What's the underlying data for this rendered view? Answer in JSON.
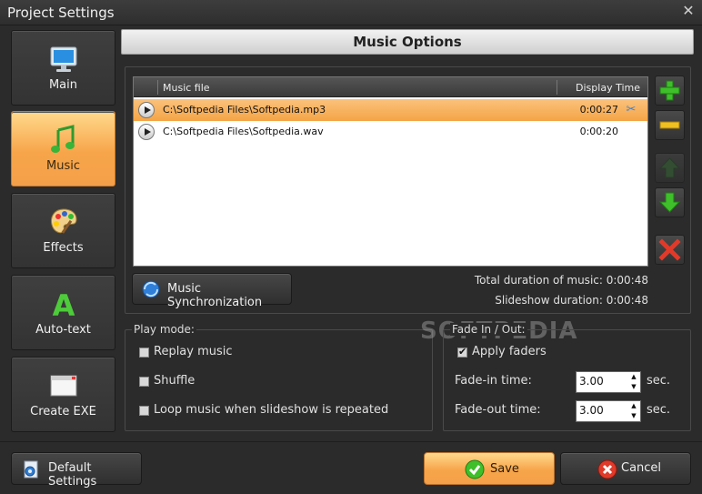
{
  "window": {
    "title": "Project Settings",
    "close_glyph": "✕"
  },
  "sidebar": {
    "items": [
      {
        "label": "Main",
        "icon": "monitor-icon"
      },
      {
        "label": "Music",
        "icon": "music-note-icon",
        "active": true
      },
      {
        "label": "Effects",
        "icon": "palette-icon"
      },
      {
        "label": "Auto-text",
        "icon": "letter-a-icon"
      },
      {
        "label": "Create EXE",
        "icon": "window-icon"
      }
    ]
  },
  "panel": {
    "title": "Music Options"
  },
  "music_list": {
    "columns": [
      "Music file",
      "Display Time"
    ],
    "rows": [
      {
        "file": "C:\\Softpedia Files\\Softpedia.mp3",
        "time": "0:00:27",
        "selected": true
      },
      {
        "file": "C:\\Softpedia Files\\Softpedia.wav",
        "time": "0:00:20",
        "selected": false
      }
    ]
  },
  "sync_button": {
    "label": "Music Synchronization"
  },
  "durations": {
    "total_music": "Total duration of music: 0:00:48",
    "slideshow": "Slideshow duration: 0:00:48"
  },
  "play_mode": {
    "legend": "Play mode:",
    "options": [
      {
        "label": "Replay music",
        "checked": false
      },
      {
        "label": "Shuffle",
        "checked": false
      },
      {
        "label": "Loop music when slideshow is repeated",
        "checked": false
      }
    ]
  },
  "fade": {
    "legend": "Fade In / Out:",
    "apply_label": "Apply faders",
    "apply_checked": true,
    "fade_in_label": "Fade-in time:",
    "fade_in_value": "3.00",
    "fade_out_label": "Fade-out time:",
    "fade_out_value": "3.00",
    "unit": "sec."
  },
  "watermark": "SOFTPEDIA",
  "footer": {
    "default_settings": "Default Settings",
    "save": "Save",
    "cancel": "Cancel"
  },
  "colors": {
    "accent_orange": "#f4a445",
    "add_green": "#3fbf2a",
    "remove_red": "#e03a2a",
    "edit_yellow": "#f0c020"
  }
}
